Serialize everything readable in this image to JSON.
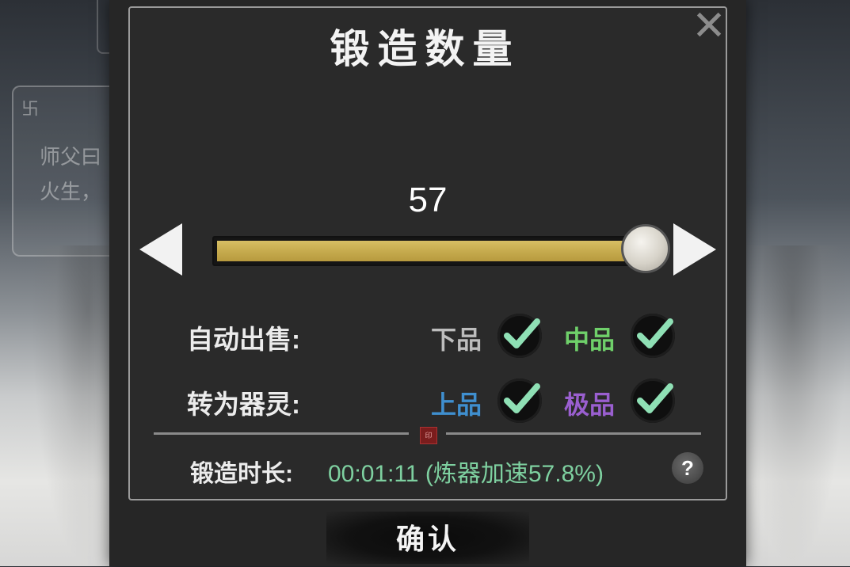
{
  "dialog": {
    "title": "锻造数量",
    "close_icon": "close-x-icon"
  },
  "quantity": {
    "value": "57",
    "slider_fraction": 1.0
  },
  "auto_sell": {
    "label": "自动出售:",
    "options": [
      {
        "label": "下品",
        "color": "#bdbdbd",
        "checked": true
      },
      {
        "label": "中品",
        "color": "#6fd06a",
        "checked": true
      }
    ]
  },
  "convert_spirit": {
    "label": "转为器灵:",
    "options": [
      {
        "label": "上品",
        "color": "#3f8fcf",
        "checked": true
      },
      {
        "label": "极品",
        "color": "#9a5fd0",
        "checked": true
      }
    ]
  },
  "duration": {
    "label": "锻造时长:",
    "value": "00:01:11 (炼器加速57.8%)"
  },
  "confirm": {
    "label": "确认"
  },
  "background": {
    "speech_line1": "师父曰",
    "speech_line2": "火生，"
  },
  "colors": {
    "check_mark": "#8fe0b5",
    "slider_fill": "#c8ad50",
    "duration_value": "#7ed0a0"
  }
}
